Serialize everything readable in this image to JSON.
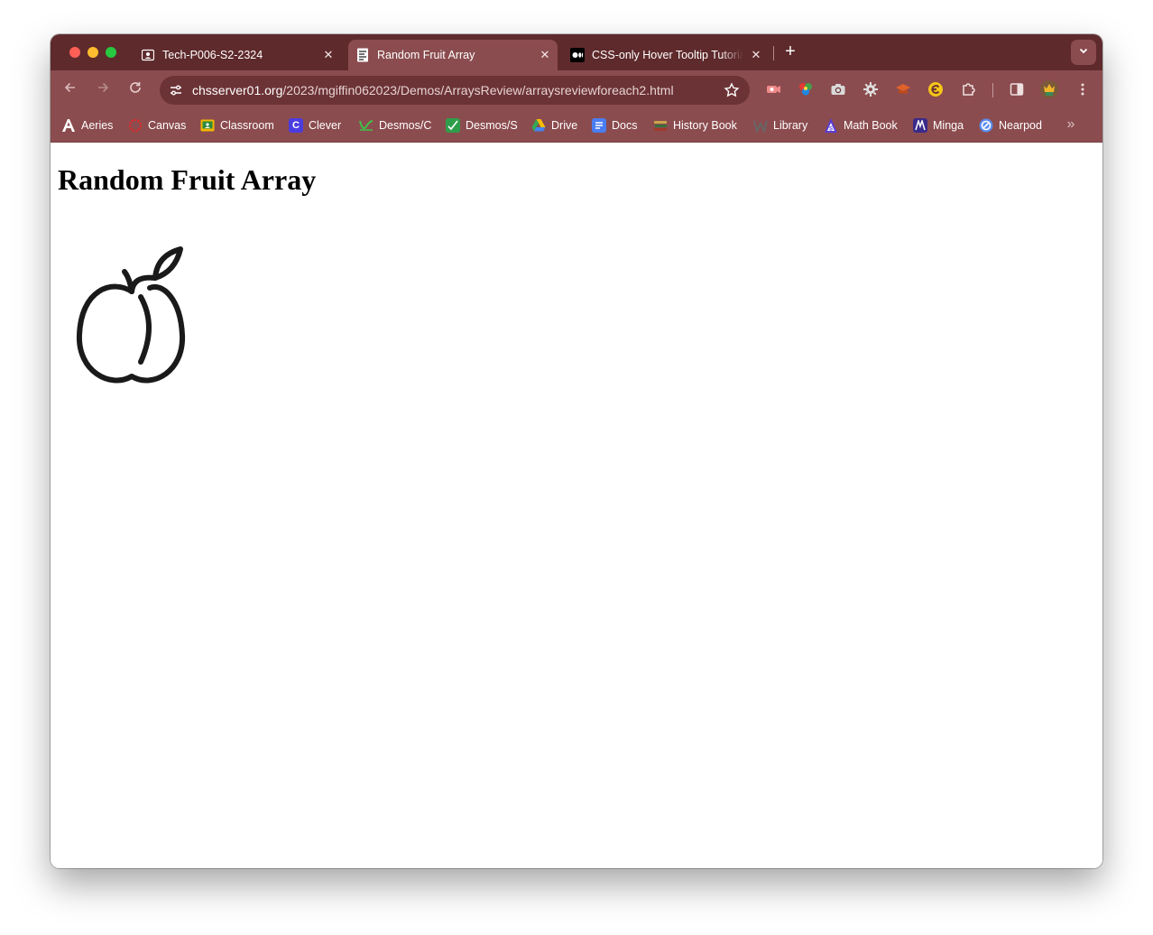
{
  "tabs": [
    {
      "title": "Tech-P006-S2-2324",
      "icon": "classroom-person-icon",
      "active": false
    },
    {
      "title": "Random Fruit Array",
      "icon": "page-favicon-icon",
      "active": true
    },
    {
      "title": "CSS-only Hover Tooltip Tutorial",
      "icon": "medium-icon",
      "active": false
    }
  ],
  "tab_close_glyph": "✕",
  "new_tab_glyph": "+",
  "address_bar": {
    "host": "chsserver01.org",
    "path": "/2023/mgiffin062023/Demos/ArraysReview/arraysreviewforeach2.html"
  },
  "bookmarks": [
    {
      "label": "Aeries",
      "icon": "aeries-icon",
      "color": "#1b3fa0"
    },
    {
      "label": "Canvas",
      "icon": "canvas-icon",
      "color": "#e02b28"
    },
    {
      "label": "Classroom",
      "icon": "classroom-icon",
      "color": "#f2b600"
    },
    {
      "label": "Clever",
      "icon": "clever-icon",
      "color": "#4b3ce0"
    },
    {
      "label": "Desmos/C",
      "icon": "desmos-c-icon",
      "color": "#2e9e4a"
    },
    {
      "label": "Desmos/S",
      "icon": "desmos-s-icon",
      "color": "#2e9e4a"
    },
    {
      "label": "Drive",
      "icon": "drive-icon",
      "color": "#34a853"
    },
    {
      "label": "Docs",
      "icon": "docs-icon",
      "color": "#4a7df0"
    },
    {
      "label": "History Book",
      "icon": "history-book-icon",
      "color": "#b08a3a"
    },
    {
      "label": "Library",
      "icon": "library-icon",
      "color": "#555555"
    },
    {
      "label": "Math Book",
      "icon": "math-book-icon",
      "color": "#5a3cd6"
    },
    {
      "label": "Minga",
      "icon": "minga-icon",
      "color": "#3a2a8a"
    },
    {
      "label": "Nearpod",
      "icon": "nearpod-icon",
      "color": "#5a8cf0"
    }
  ],
  "bookmarks_overflow": "»",
  "page": {
    "heading": "Random Fruit Array",
    "image_icon": "peach-icon"
  },
  "colors": {
    "tabstrip": "#5f2a2c",
    "toolbar": "#8b4c4f",
    "omnibox": "#6c3336"
  }
}
